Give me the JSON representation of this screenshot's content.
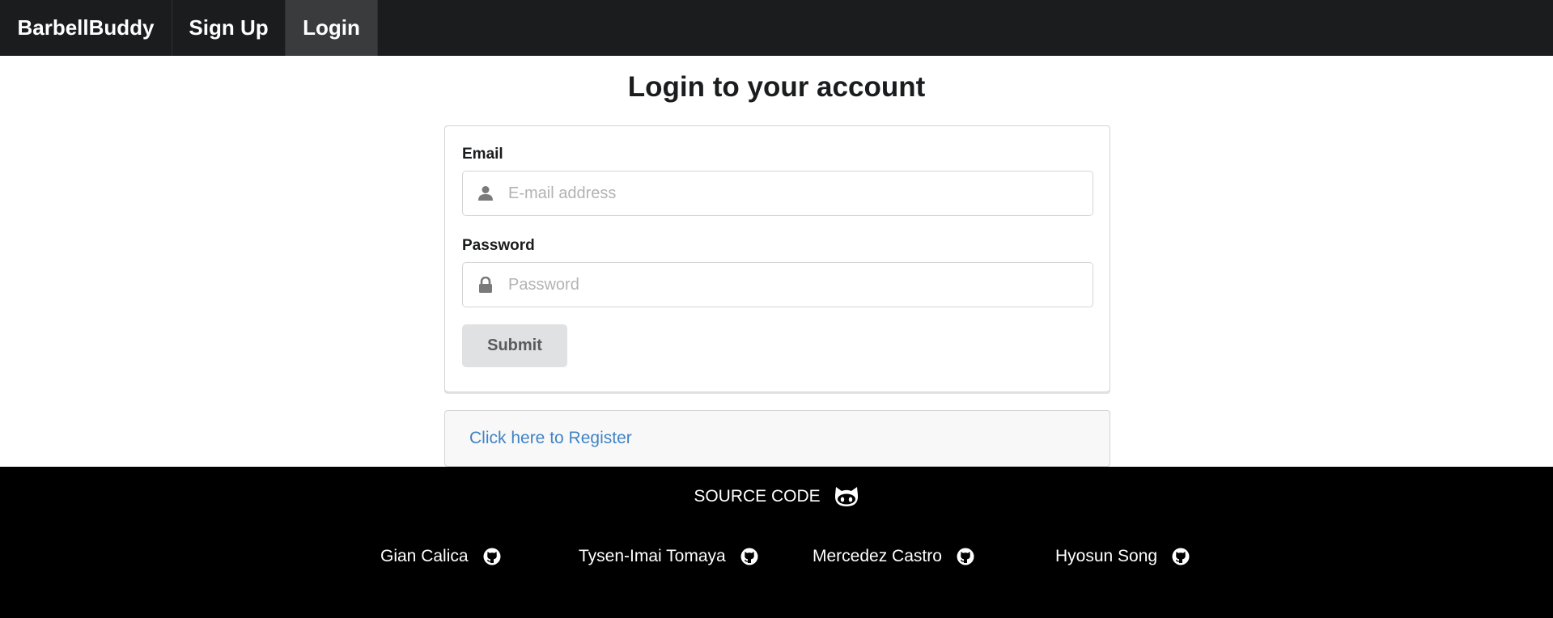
{
  "navbar": {
    "brand": "BarbellBuddy",
    "signup": "Sign Up",
    "login": "Login"
  },
  "page": {
    "title": "Login to your account"
  },
  "form": {
    "email_label": "Email",
    "email_placeholder": "E-mail address",
    "email_icon": "user-icon",
    "password_label": "Password",
    "password_placeholder": "Password",
    "password_icon": "lock-icon",
    "submit_label": "Submit"
  },
  "register": {
    "link_text": "Click here to Register"
  },
  "footer": {
    "source_label": "SOURCE CODE",
    "source_icon": "github-octocat-icon",
    "authors": [
      {
        "name": "Gian Calica",
        "icon": "github-icon"
      },
      {
        "name": "Tysen-Imai Tomaya",
        "icon": "github-icon"
      },
      {
        "name": "Mercedez Castro",
        "icon": "github-icon"
      },
      {
        "name": "Hyosun Song",
        "icon": "github-icon"
      }
    ]
  },
  "colors": {
    "navbar_bg": "#1b1c1d",
    "active_tab_bg": "#3a3b3c",
    "link": "#4183c4",
    "button_bg": "#e0e1e2",
    "footer_bg": "#000000"
  }
}
